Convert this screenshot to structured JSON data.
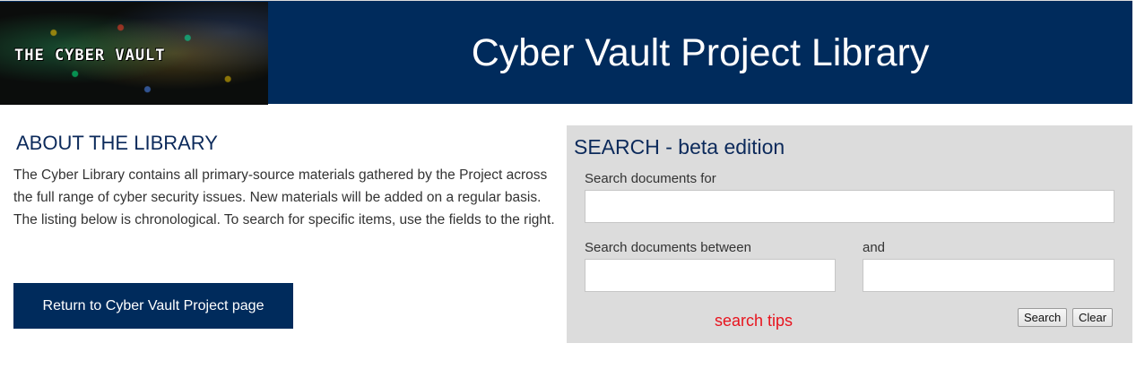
{
  "header": {
    "logo_text": "THE CYBER VAULT",
    "title": "Cyber Vault Project Library"
  },
  "about": {
    "heading": "ABOUT THE LIBRARY",
    "text": "The Cyber Library contains all primary-source materials gathered by the Project across the full range of cyber security issues. New materials will be added on a regular basis. The listing below is chronological. To search for specific items, use the fields to the right.",
    "return_button": "Return to Cyber Vault Project page"
  },
  "search": {
    "heading": "SEARCH - beta edition",
    "query_label": "Search documents for",
    "query_value": "",
    "between_label": "Search documents between",
    "and_label": "and",
    "date_from_value": "",
    "date_to_value": "",
    "tips_link": "search tips",
    "search_button": "Search",
    "clear_button": "Clear"
  },
  "colors": {
    "header_bg": "#002b5c",
    "heading_text": "#0c2a5b",
    "panel_bg": "#dcdcdc",
    "tips_link": "#e8141e"
  }
}
